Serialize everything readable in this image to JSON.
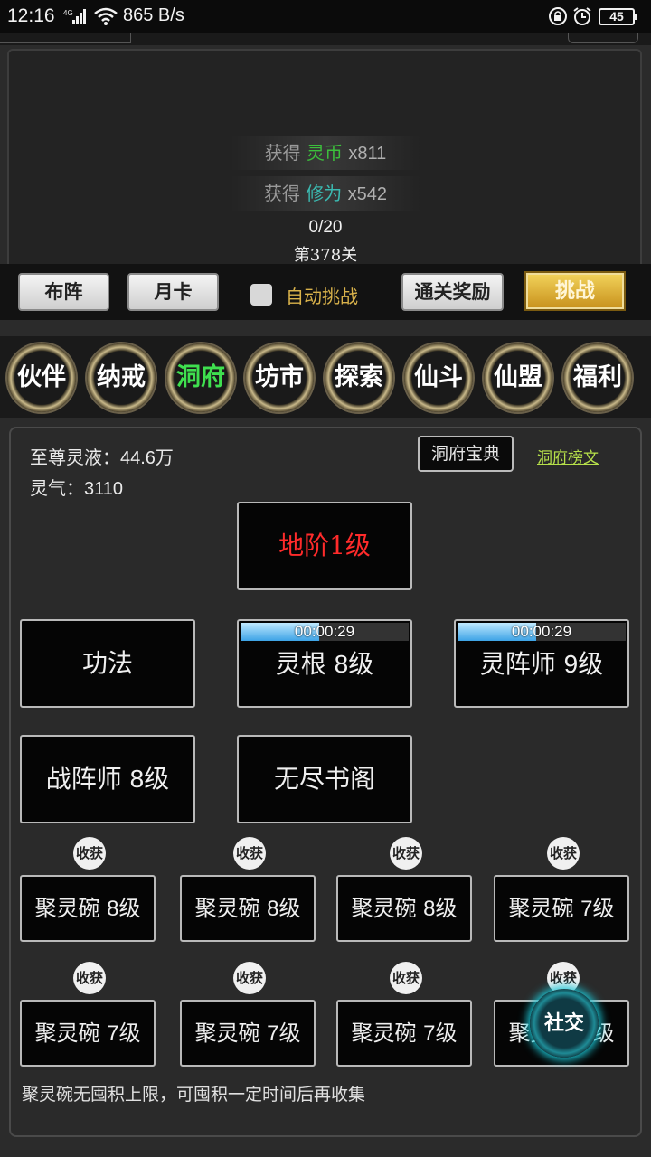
{
  "status_bar": {
    "time": "12:16",
    "network_speed": "865 B/s",
    "battery": "45"
  },
  "battle": {
    "rewards": [
      {
        "prefix": "获得",
        "item": "灵币",
        "amount": "x811",
        "color": "#3cbf3c"
      },
      {
        "prefix": "获得",
        "item": "修为",
        "amount": "x542",
        "color": "#3bb9b0"
      }
    ],
    "progress": "0/20",
    "stage": "第378关",
    "buttons": {
      "formation": "布阵",
      "monthly_card": "月卡",
      "auto_challenge": "自动挑战",
      "clear_rewards": "通关奖励",
      "challenge": "挑战"
    }
  },
  "nav": {
    "items": [
      "伙伴",
      "纳戒",
      "洞府",
      "坊市",
      "探索",
      "仙斗",
      "仙盟",
      "福利"
    ],
    "active_index": 2,
    "active_color": "#3fe04f"
  },
  "cave": {
    "supreme_liquid_label": "至尊灵液：",
    "supreme_liquid_value": "44.6万",
    "spirit_qi_label": "灵气：",
    "spirit_qi_value": "3110",
    "treasure_book": "洞府宝典",
    "rank_link": "洞府榜文",
    "tier": "地阶1级",
    "buildings": {
      "gongfa": "功法",
      "spirit_root": {
        "name": "灵根",
        "level": "8级",
        "timer": "00:00:29",
        "timer_fill": 0.47
      },
      "array_master": {
        "name": "灵阵师",
        "level": "9级",
        "timer": "00:00:29",
        "timer_fill": 0.47
      },
      "war_array_master": {
        "name": "战阵师",
        "level": "8级"
      },
      "endless_library": "无尽书阁"
    },
    "harvest_label": "收获",
    "bowls_row1": [
      {
        "name": "聚灵碗",
        "level": "8级"
      },
      {
        "name": "聚灵碗",
        "level": "8级"
      },
      {
        "name": "聚灵碗",
        "level": "8级"
      },
      {
        "name": "聚灵碗",
        "level": "7级"
      }
    ],
    "bowls_row2": [
      {
        "name": "聚灵碗",
        "level": "7级"
      },
      {
        "name": "聚灵碗",
        "level": "7级"
      },
      {
        "name": "聚灵碗",
        "level": "7级"
      },
      {
        "name": "聚灵碗",
        "level": "7级"
      }
    ],
    "note": "聚灵碗无囤积上限，可囤积一定时间后再收集",
    "social_button": "社交"
  }
}
